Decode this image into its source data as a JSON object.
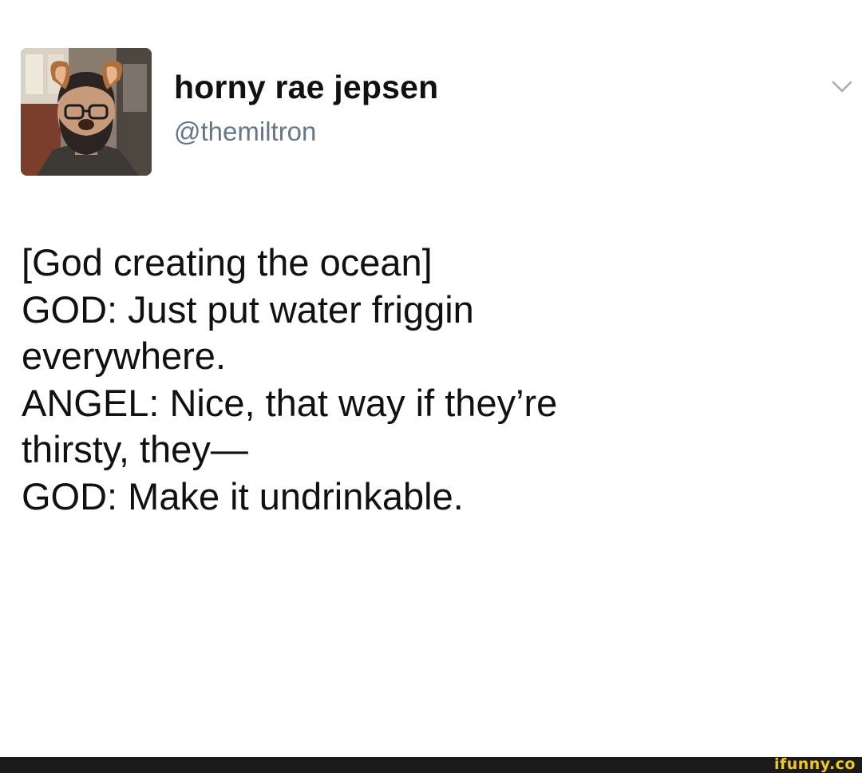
{
  "tweet": {
    "display_name": "horny rae jepsen",
    "handle": "@themiltron",
    "lines": [
      "[God creating the ocean]",
      "GOD: Just put water friggin",
      "everywhere.",
      "ANGEL: Nice, that way if they’re",
      "thirsty, they—",
      "GOD: Make it undrinkable."
    ],
    "menu_icon": "chevron-down-icon",
    "avatar_icon": "avatar-photo"
  },
  "watermark": {
    "text": "ifunny.co",
    "color": "#f2c81b"
  },
  "colors": {
    "background": "#ffffff",
    "text": "#111111",
    "handle": "#657786",
    "footer": "#1b1b1b"
  }
}
